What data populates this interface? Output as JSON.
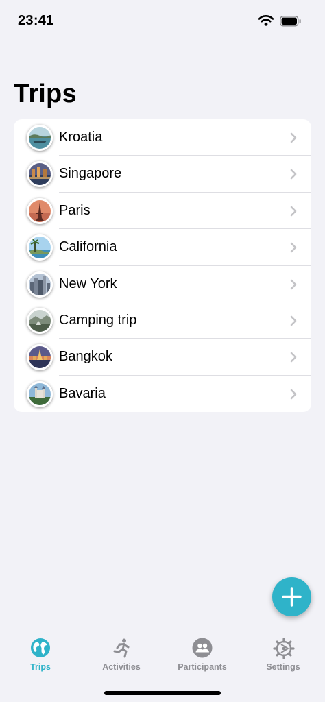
{
  "status": {
    "time": "23:41"
  },
  "title": "Trips",
  "trips": [
    {
      "name": "Kroatia",
      "thumb": "coast-photo"
    },
    {
      "name": "Singapore",
      "thumb": "city-night-photo"
    },
    {
      "name": "Paris",
      "thumb": "eiffel-tower-photo"
    },
    {
      "name": "California",
      "thumb": "palm-coast-photo"
    },
    {
      "name": "New York",
      "thumb": "skyline-photo"
    },
    {
      "name": "Camping trip",
      "thumb": "camp-landscape-photo"
    },
    {
      "name": "Bangkok",
      "thumb": "temple-photo"
    },
    {
      "name": "Bavaria",
      "thumb": "castle-photo"
    }
  ],
  "fab": {
    "icon": "plus-icon"
  },
  "tabs": [
    {
      "label": "Trips",
      "icon": "globe-icon",
      "active": true
    },
    {
      "label": "Activities",
      "icon": "running-icon",
      "active": false
    },
    {
      "label": "Participants",
      "icon": "people-icon",
      "active": false
    },
    {
      "label": "Settings",
      "icon": "gear-icon",
      "active": false
    }
  ],
  "colors": {
    "accent": "#2fb3c9",
    "inactive": "#8e8e93",
    "background": "#f2f2f7"
  }
}
